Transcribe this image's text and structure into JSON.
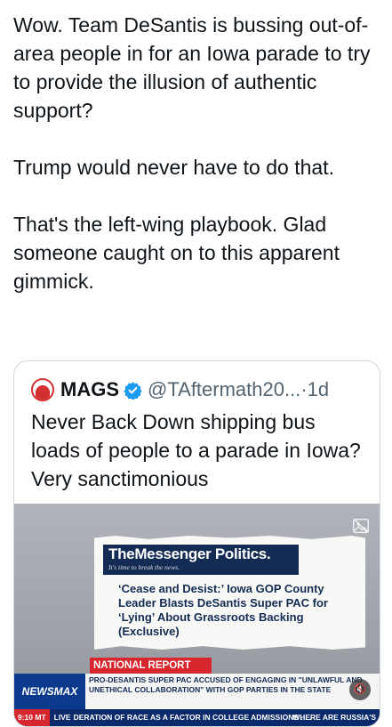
{
  "tweet": {
    "paragraphs": [
      "Wow. Team DeSantis is bussing out-of-area people in for an Iowa parade to try to provide the illusion of authentic support?",
      "Trump would never have to do that.",
      "That's the left-wing playbook. Glad someone caught on to this apparent gimmick."
    ]
  },
  "quote": {
    "name": "MAGS",
    "handle": "@TAftermath20...",
    "separator": "·",
    "time": "1d",
    "text": "Never Back Down shipping bus loads of people to a parade in Iowa? Very sanctimonious",
    "avatar_icon": "avatar-logo",
    "verified_icon": "verified-badge-icon",
    "verified_color": "#1d9bf0"
  },
  "media": {
    "corner_icon": "alt-image-icon",
    "brand_name": "TheMessenger",
    "brand_section": "Politics.",
    "brand_tagline": "It's time to break the news.",
    "headline": "‘Cease and Desist:’ Iowa GOP County Leader Blasts DeSantis Super PAC for ‘Lying’ About Grassroots Backing (Exclusive)",
    "news_label": "NATIONAL REPORT",
    "network": "NEWSMAX",
    "news_text": "PRO-DESANTIS SUPER PAC ACCUSED OF ENGAGING IN \"UNLAWFUL AND UNETHICAL COLLABORATION\" WITH GOP PARTIES IN THE STATE",
    "mute_icon": "mute-icon",
    "crawl_time": "9:10 MT",
    "crawl_live": "LIVE",
    "crawl_text": "DERATION OF RACE AS A FACTOR IN COLLEGE ADMISSIONS . . .",
    "crawl_text2": "WHERE ARE RUSSIA'S",
    "brand_color": "#142c54",
    "alert_color": "#d7262e"
  }
}
